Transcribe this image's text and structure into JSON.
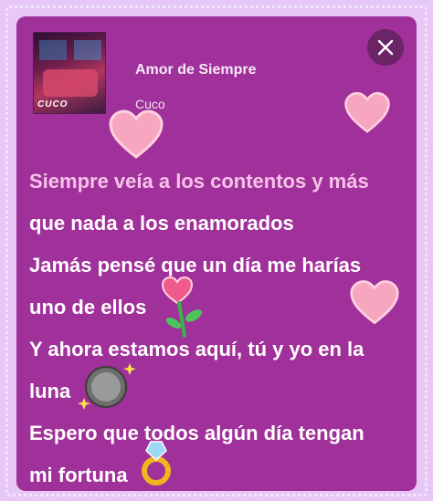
{
  "track": {
    "title": "Amor de Siempre",
    "artist": "Cuco",
    "album_logo_text": "CUCO"
  },
  "lyrics": [
    "Siempre veía a los contentos y más",
    "que nada a los enamorados",
    "Jamás pensé que un día me harías",
    "uno de ellos",
    "Y ahora estamos aquí, tú y yo en la",
    "luna",
    "Espero que todos algún día tengan",
    "mi fortuna"
  ],
  "colors": {
    "card_bg": "#a0309a",
    "outer_bg": "#e7c7f5",
    "active_line": "#f7c3e9",
    "lyric_text": "#ffffff",
    "heart": "#f7a6c0"
  },
  "stickers": [
    "heart-sticker",
    "heart-sticker",
    "heart-sticker",
    "heart-flower-sticker",
    "moon-sticker",
    "ring-sticker"
  ]
}
